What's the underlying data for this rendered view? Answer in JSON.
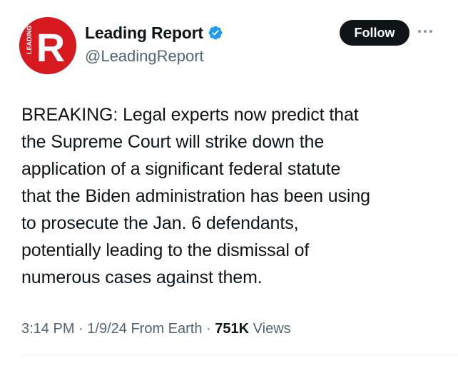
{
  "author": {
    "display_name": "Leading Report",
    "handle": "@LeadingReport",
    "avatar_letter": "R",
    "avatar_side_text": "LEADING",
    "verified_icon": "verified-badge-icon",
    "avatar_color": "#d71920",
    "verified_color": "#1d9bf0"
  },
  "actions": {
    "follow_label": "Follow",
    "more_icon": "more-dots-icon"
  },
  "tweet": {
    "text": "BREAKING: Legal experts now predict that\nthe Supreme Court will strike down the\napplication of a significant federal statute\nthat the Biden administration has been using\nto prosecute the Jan. 6 defendants,\npotentially leading to the dismissal of\nnumerous cases against them."
  },
  "meta": {
    "time": "3:14 PM",
    "separator": "·",
    "date": "1/9/24",
    "source": "From Earth",
    "views_count": "751K",
    "views_label": "Views"
  }
}
